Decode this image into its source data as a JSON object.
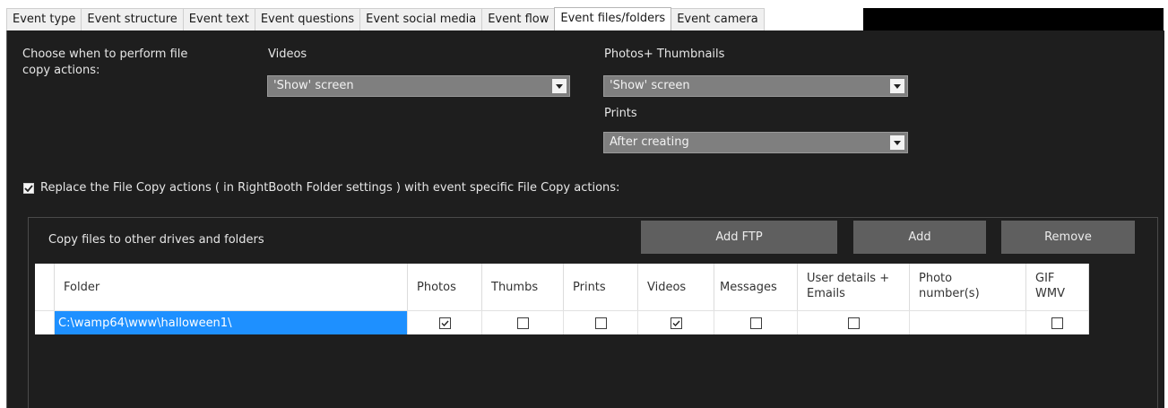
{
  "tabs": [
    {
      "label": "Event type",
      "active": false
    },
    {
      "label": "Event structure",
      "active": false
    },
    {
      "label": "Event text",
      "active": false
    },
    {
      "label": "Event questions",
      "active": false
    },
    {
      "label": "Event social media",
      "active": false
    },
    {
      "label": "Event flow",
      "active": false
    },
    {
      "label": "Event files/folders",
      "active": true
    },
    {
      "label": "Event camera",
      "active": false
    }
  ],
  "copy_actions": {
    "label_line1": "Choose when to perform file",
    "label_line2": "copy actions:",
    "videos": {
      "label": "Videos",
      "value": "'Show' screen"
    },
    "photos": {
      "label": "Photos+ Thumbnails",
      "value": "'Show' screen"
    },
    "prints": {
      "label": "Prints",
      "value": "After creating"
    }
  },
  "replace": {
    "checked": true,
    "label": "Replace the File Copy actions ( in RightBooth Folder settings ) with event specific File Copy actions:"
  },
  "copy_group": {
    "title": "Copy files to other drives and folders",
    "add_ftp_label": "Add FTP",
    "add_label": "Add",
    "remove_label": "Remove"
  },
  "table": {
    "headers": {
      "folder": "Folder",
      "photos": "Photos",
      "thumbs": "Thumbs",
      "prints": "Prints",
      "videos": "Videos",
      "messages": "Messages",
      "user_details_1": "User details +",
      "user_details_2": "Emails",
      "photo_number_1": "Photo",
      "photo_number_2": "number(s)",
      "gif_1": "GIF",
      "gif_2": "WMV"
    },
    "rows": [
      {
        "folder": "C:\\wamp64\\www\\halloween1\\",
        "photos": true,
        "thumbs": false,
        "prints": false,
        "videos": true,
        "messages": false,
        "user_details": false,
        "photo_numbers": "",
        "gif_wmv": false
      }
    ]
  },
  "icons": {
    "dropdown": "chevron-down-icon",
    "check": "checkmark-icon"
  },
  "colors": {
    "panel_bg": "#1e1e1e",
    "select_bg": "#7f7f7f",
    "button_bg": "#5f5f5f",
    "selection_blue": "#1e90ff"
  }
}
